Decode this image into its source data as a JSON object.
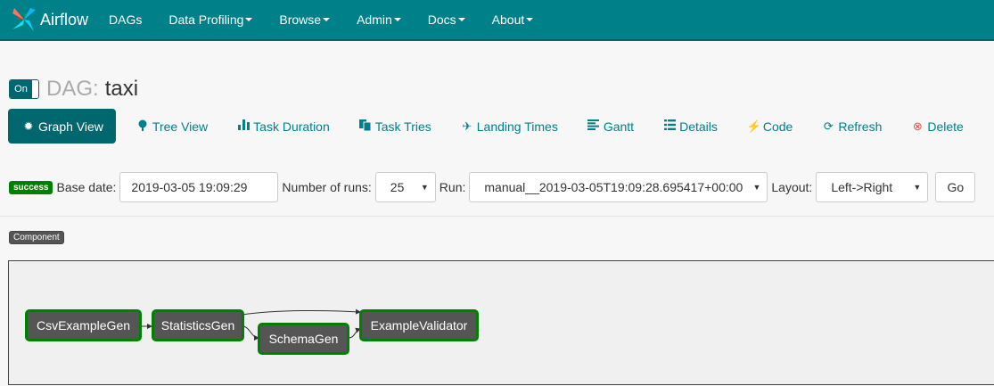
{
  "navbar": {
    "brand": "Airflow",
    "items": [
      {
        "label": "DAGs",
        "dropdown": false
      },
      {
        "label": "Data Profiling",
        "dropdown": true
      },
      {
        "label": "Browse",
        "dropdown": true
      },
      {
        "label": "Admin",
        "dropdown": true
      },
      {
        "label": "Docs",
        "dropdown": true
      },
      {
        "label": "About",
        "dropdown": true
      }
    ]
  },
  "dag": {
    "toggle_label": "On",
    "prefix": "DAG:",
    "name": "taxi"
  },
  "tabs": [
    {
      "label": "Graph View",
      "icon": "gear-icon",
      "active": true
    },
    {
      "label": "Tree View",
      "icon": "tree-icon"
    },
    {
      "label": "Task Duration",
      "icon": "bar-chart-icon"
    },
    {
      "label": "Task Tries",
      "icon": "duplicate-icon"
    },
    {
      "label": "Landing Times",
      "icon": "plane-icon"
    },
    {
      "label": "Gantt",
      "icon": "align-left-icon"
    },
    {
      "label": "Details",
      "icon": "list-icon"
    },
    {
      "label": "Code",
      "icon": "flash-icon"
    },
    {
      "label": "Refresh",
      "icon": "refresh-icon"
    },
    {
      "label": "Delete",
      "icon": "remove-circle-icon"
    }
  ],
  "filters": {
    "status_badge": "success",
    "base_date_label": "Base date:",
    "base_date_value": "2019-03-05 19:09:29",
    "num_runs_label": "Number of runs:",
    "num_runs_value": "25",
    "run_label": "Run:",
    "run_value": "manual__2019-03-05T19:09:28.695417+00:00",
    "layout_label": "Layout:",
    "layout_value": "Left->Right",
    "go_label": "Go"
  },
  "legend": {
    "component": "Component"
  },
  "graph": {
    "nodes": [
      {
        "label": "CsvExampleGen"
      },
      {
        "label": "StatisticsGen"
      },
      {
        "label": "SchemaGen"
      },
      {
        "label": "ExampleValidator"
      }
    ]
  },
  "colors": {
    "navbar": "#00818a",
    "active_tab": "#00676e",
    "link": "#00818a",
    "success": "#008000",
    "node_fill": "#555555"
  }
}
